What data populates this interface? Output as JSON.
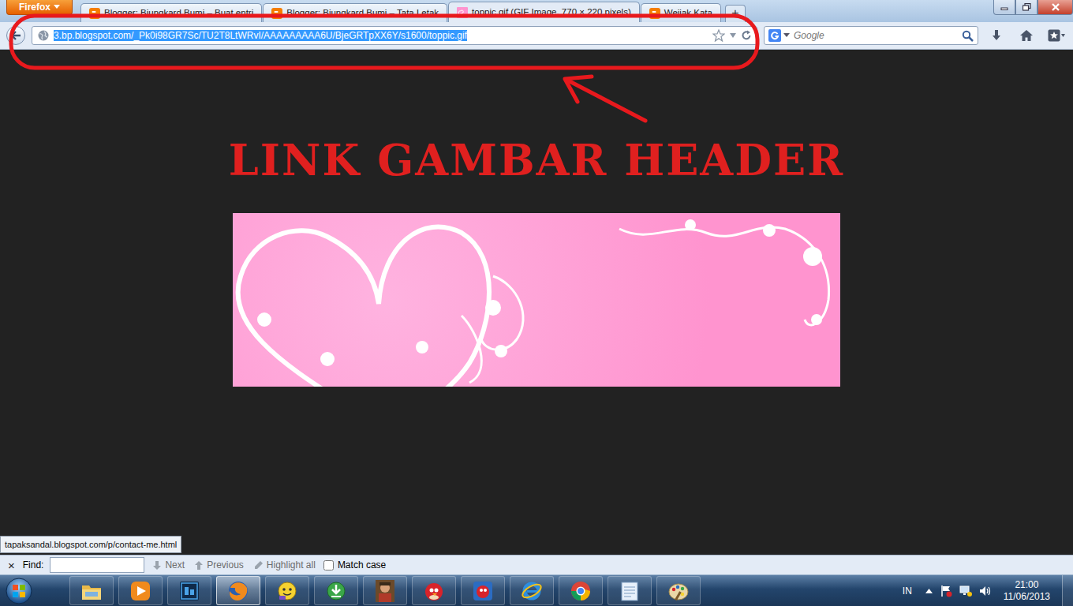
{
  "browser": {
    "menu_button": "Firefox",
    "tabs": [
      {
        "label": "Blogger: Bjungkard Bumi – Buat entri",
        "kind": "blogger",
        "selected": false
      },
      {
        "label": "Blogger: Bjungkard Bumi – Tata Letak",
        "kind": "blogger",
        "selected": false
      },
      {
        "label": "toppic.gif (GIF Image, 770 × 220 pixels)",
        "kind": "image",
        "selected": true
      },
      {
        "label": "Wejiak Kata",
        "kind": "blogger",
        "selected": false
      }
    ],
    "new_tab": "+"
  },
  "address_bar": {
    "url": "3.bp.blogspot.com/_Pk0i98GR7Sc/TU2T8LtWRvI/AAAAAAAAA6U/BjeGRTpXX6Y/s1600/toppic.gif",
    "selected": true
  },
  "search": {
    "placeholder": "Google"
  },
  "page": {
    "heading": "LINK GAMBAR HEADER"
  },
  "status_link": "tapaksandal.blogspot.com/p/contact-me.html",
  "find_bar": {
    "close": "×",
    "label": "Find:",
    "value": "",
    "buttons": [
      {
        "label": "Next",
        "kind": "next",
        "disabled": true
      },
      {
        "label": "Previous",
        "kind": "previous",
        "disabled": true
      },
      {
        "label": "Highlight all",
        "kind": "highlight",
        "disabled": true
      }
    ],
    "match_case": {
      "label": "Match case",
      "checked": false
    }
  },
  "taskbar": {
    "apps": [
      {
        "kind": "explorer",
        "selected": false
      },
      {
        "kind": "media",
        "selected": false
      },
      {
        "kind": "photoshop",
        "selected": false
      },
      {
        "kind": "firefox",
        "selected": true
      },
      {
        "kind": "messenger",
        "selected": false
      },
      {
        "kind": "download",
        "selected": false
      },
      {
        "kind": "game",
        "selected": false
      },
      {
        "kind": "angrybirds",
        "selected": false
      },
      {
        "kind": "angrybirds-rio",
        "selected": false
      },
      {
        "kind": "ie",
        "selected": false
      },
      {
        "kind": "chrome",
        "selected": false
      },
      {
        "kind": "notes",
        "selected": false
      },
      {
        "kind": "paint",
        "selected": false
      }
    ],
    "language": "IN",
    "time": "21:00",
    "date": "11/06/2013"
  }
}
